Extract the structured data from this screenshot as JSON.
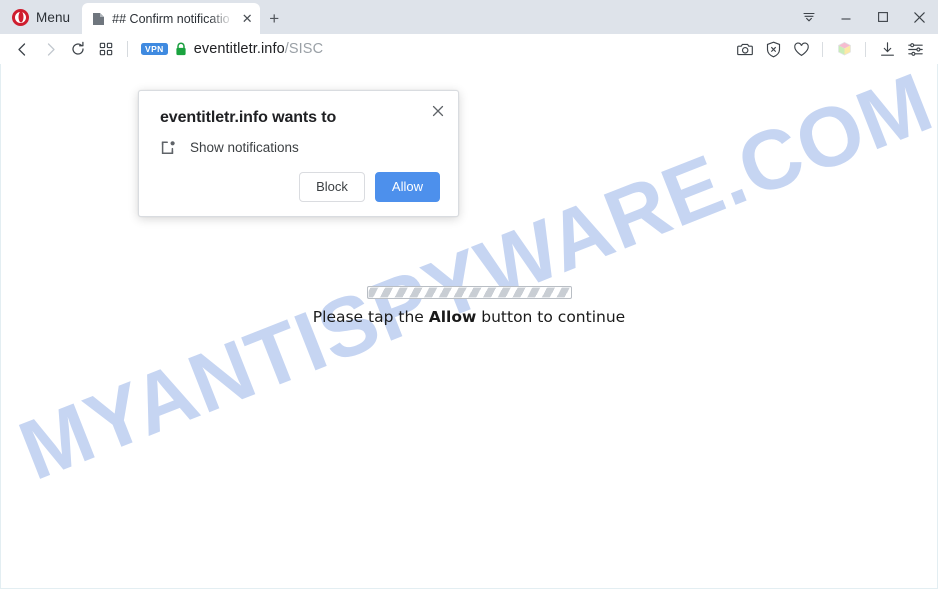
{
  "window": {
    "menu_label": "Menu",
    "controls": {
      "tab_menu": "tab-list-chevron",
      "minimize": "–",
      "maximize": "□",
      "close": "✕"
    }
  },
  "tabs": [
    {
      "title": "## Confirm notificatio",
      "favicon": "page-icon",
      "close_label": "✕"
    }
  ],
  "new_tab_label": "+",
  "navbar": {
    "back": "‹",
    "forward": "›",
    "reload": "reload",
    "apps": "apps-grid",
    "vpn_badge": "VPN",
    "url_domain": "eventitletr.info",
    "url_path": "/SISC",
    "right_icons": [
      "snapshot-camera-icon",
      "ad-block-shield-icon",
      "heart-icon",
      "crypto-wallet-cube-icon",
      "downloads-icon",
      "easy-setup-sliders-icon"
    ]
  },
  "permission_dialog": {
    "title": "eventitletr.info wants to",
    "permission_label": "Show notifications",
    "permission_icon": "notification-bell-icon",
    "close_label": "✕",
    "block_label": "Block",
    "allow_label": "Allow",
    "allow_color": "#4d90ec"
  },
  "page": {
    "watermark": "MYANTISPYWARE.COM",
    "watermark_color": "#c3d3f2",
    "progress_label": "indeterminate-striped-progress",
    "message_prefix": "Please tap the ",
    "message_emphasis": "Allow",
    "message_suffix": " button to continue"
  }
}
